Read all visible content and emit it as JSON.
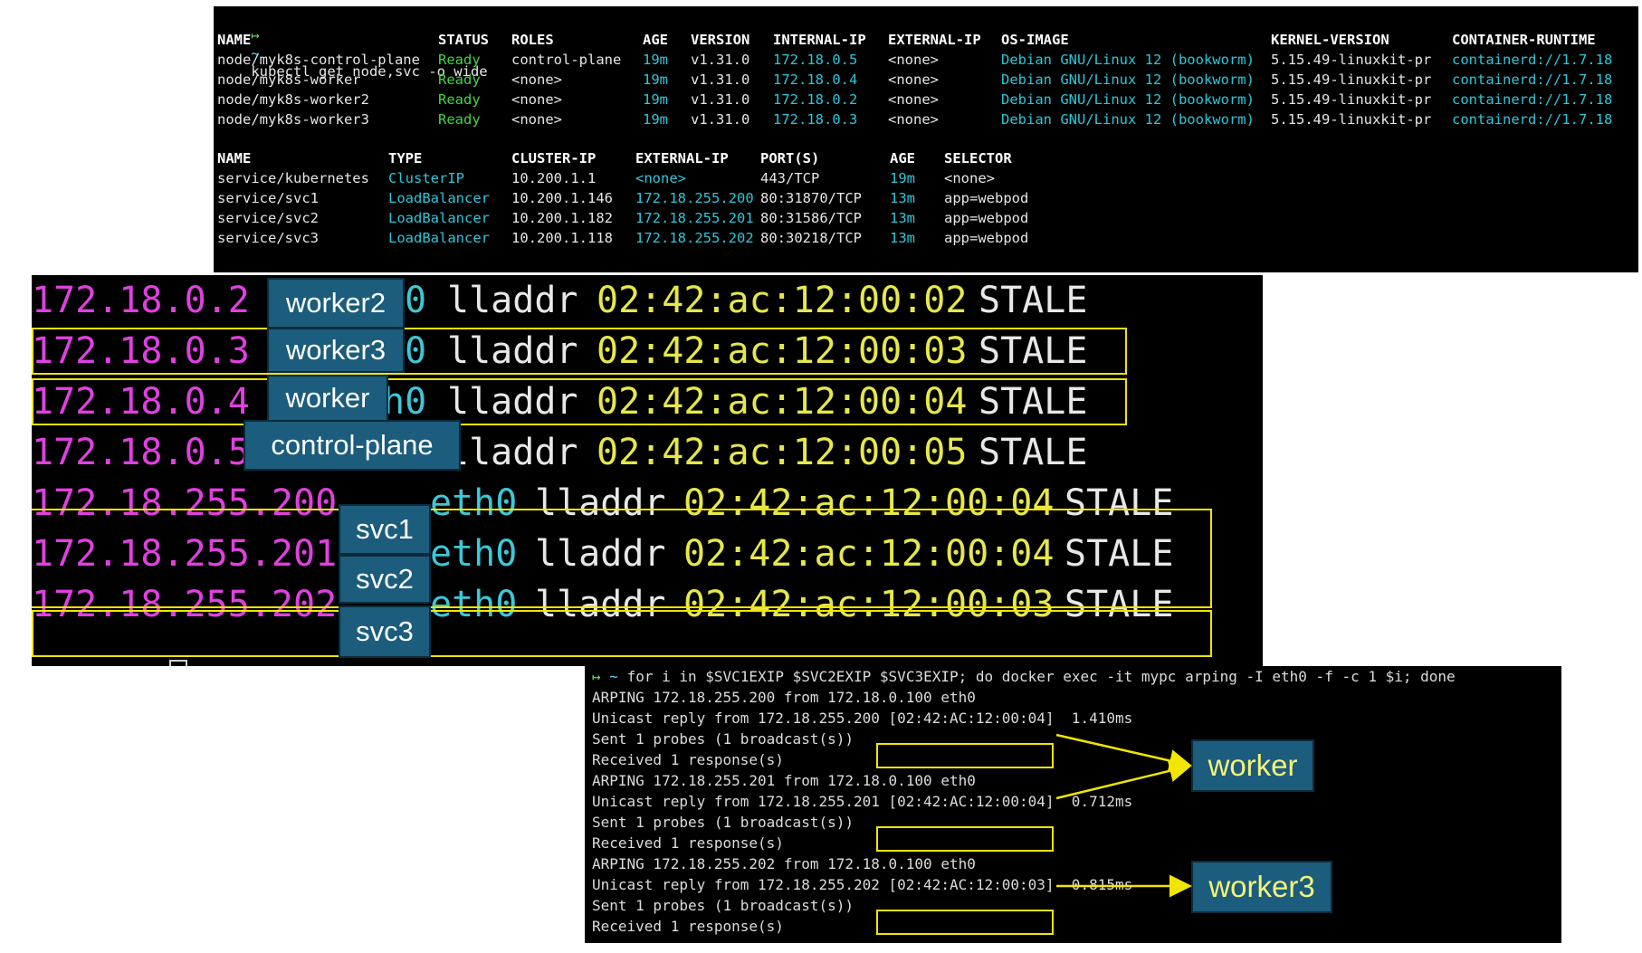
{
  "panel1": {
    "prompt_arrow": "↦",
    "prompt_tilde": "~",
    "command": "kubectl get node,svc -o wide",
    "node_headers": [
      "NAME",
      "STATUS",
      "ROLES",
      "AGE",
      "VERSION",
      "INTERNAL-IP",
      "EXTERNAL-IP",
      "OS-IMAGE",
      "KERNEL-VERSION",
      "CONTAINER-RUNTIME"
    ],
    "nodes": [
      [
        "node/myk8s-control-plane",
        "Ready",
        "control-plane",
        "19m",
        "v1.31.0",
        "172.18.0.5",
        "<none>",
        "Debian GNU/Linux 12 (bookworm)",
        "5.15.49-linuxkit-pr",
        "containerd://1.7.18"
      ],
      [
        "node/myk8s-worker",
        "Ready",
        "<none>",
        "19m",
        "v1.31.0",
        "172.18.0.4",
        "<none>",
        "Debian GNU/Linux 12 (bookworm)",
        "5.15.49-linuxkit-pr",
        "containerd://1.7.18"
      ],
      [
        "node/myk8s-worker2",
        "Ready",
        "<none>",
        "19m",
        "v1.31.0",
        "172.18.0.2",
        "<none>",
        "Debian GNU/Linux 12 (bookworm)",
        "5.15.49-linuxkit-pr",
        "containerd://1.7.18"
      ],
      [
        "node/myk8s-worker3",
        "Ready",
        "<none>",
        "19m",
        "v1.31.0",
        "172.18.0.3",
        "<none>",
        "Debian GNU/Linux 12 (bookworm)",
        "5.15.49-linuxkit-pr",
        "containerd://1.7.18"
      ]
    ],
    "svc_headers": [
      "NAME",
      "TYPE",
      "CLUSTER-IP",
      "EXTERNAL-IP",
      "PORT(S)",
      "AGE",
      "SELECTOR"
    ],
    "services": [
      [
        "service/kubernetes",
        "ClusterIP",
        "10.200.1.1",
        "<none>",
        "443/TCP",
        "19m",
        "<none>"
      ],
      [
        "service/svc1",
        "LoadBalancer",
        "10.200.1.146",
        "172.18.255.200",
        "80:31870/TCP",
        "13m",
        "app=webpod"
      ],
      [
        "service/svc2",
        "LoadBalancer",
        "10.200.1.182",
        "172.18.255.201",
        "80:31586/TCP",
        "13m",
        "app=webpod"
      ],
      [
        "service/svc3",
        "LoadBalancer",
        "10.200.1.118",
        "172.18.255.202",
        "80:30218/TCP",
        "13m",
        "app=webpod"
      ]
    ]
  },
  "panel2": {
    "rows": [
      {
        "ip": "172.18.0.2",
        "dev_tail": "0",
        "lladdr": "lladdr",
        "mac": "02:42:ac:12:00:02",
        "state": "STALE",
        "tag": "worker2"
      },
      {
        "ip": "172.18.0.3",
        "dev_tail": "0",
        "lladdr": "lladdr",
        "mac": "02:42:ac:12:00:03",
        "state": "STALE",
        "tag": "worker3"
      },
      {
        "ip": "172.18.0.4",
        "dev_tail": "h0",
        "lladdr": "lladdr",
        "mac": "02:42:ac:12:00:04",
        "state": "STALE",
        "tag": "worker"
      },
      {
        "ip": "172.18.0.5",
        "dev_tail": "",
        "lladdr": "lladdr",
        "mac": "02:42:ac:12:00:05",
        "state": "STALE",
        "tag": "control-plane"
      },
      {
        "ip": "172.18.255.200",
        "dev_tail": "eth0",
        "lladdr": "lladdr",
        "mac": "02:42:ac:12:00:04",
        "state": "STALE",
        "tag": "svc1"
      },
      {
        "ip": "172.18.255.201",
        "dev_tail": "eth0",
        "lladdr": "lladdr",
        "mac": "02:42:ac:12:00:04",
        "state": "STALE",
        "tag": "svc2"
      },
      {
        "ip": "172.18.255.202",
        "dev_tail": "eth0",
        "lladdr": "lladdr",
        "mac": "02:42:ac:12:00:03",
        "state": "STALE",
        "tag": "svc3"
      }
    ]
  },
  "panel3": {
    "command": "for i in $SVC1EXIP $SVC2EXIP $SVC3EXIP; do docker exec -it mypc arping -I eth0 -f -c 1 $i; done",
    "lines": [
      "ARPING 172.18.255.200 from 172.18.0.100 eth0",
      "Unicast reply from 172.18.255.200 [02:42:AC:12:00:04]  1.410ms",
      "Sent 1 probes (1 broadcast(s))",
      "Received 1 response(s)",
      "ARPING 172.18.255.201 from 172.18.0.100 eth0",
      "Unicast reply from 172.18.255.201 [02:42:AC:12:00:04]  0.712ms",
      "Sent 1 probes (1 broadcast(s))",
      "Received 1 response(s)",
      "ARPING 172.18.255.202 from 172.18.0.100 eth0",
      "Unicast reply from 172.18.255.202 [02:42:AC:12:00:03]  0.815ms",
      "Sent 1 probes (1 broadcast(s))",
      "Received 1 response(s)"
    ]
  },
  "callouts": {
    "worker": "worker",
    "worker3": "worker3"
  },
  "colors": {
    "tag_bg": "#1c5c7c",
    "highlight": "#f2e600",
    "ip_magenta": "#e040e0",
    "mac_yellow": "#e6e84a",
    "ready_green": "#46d246",
    "ip_cyan": "#2ec6d9"
  }
}
